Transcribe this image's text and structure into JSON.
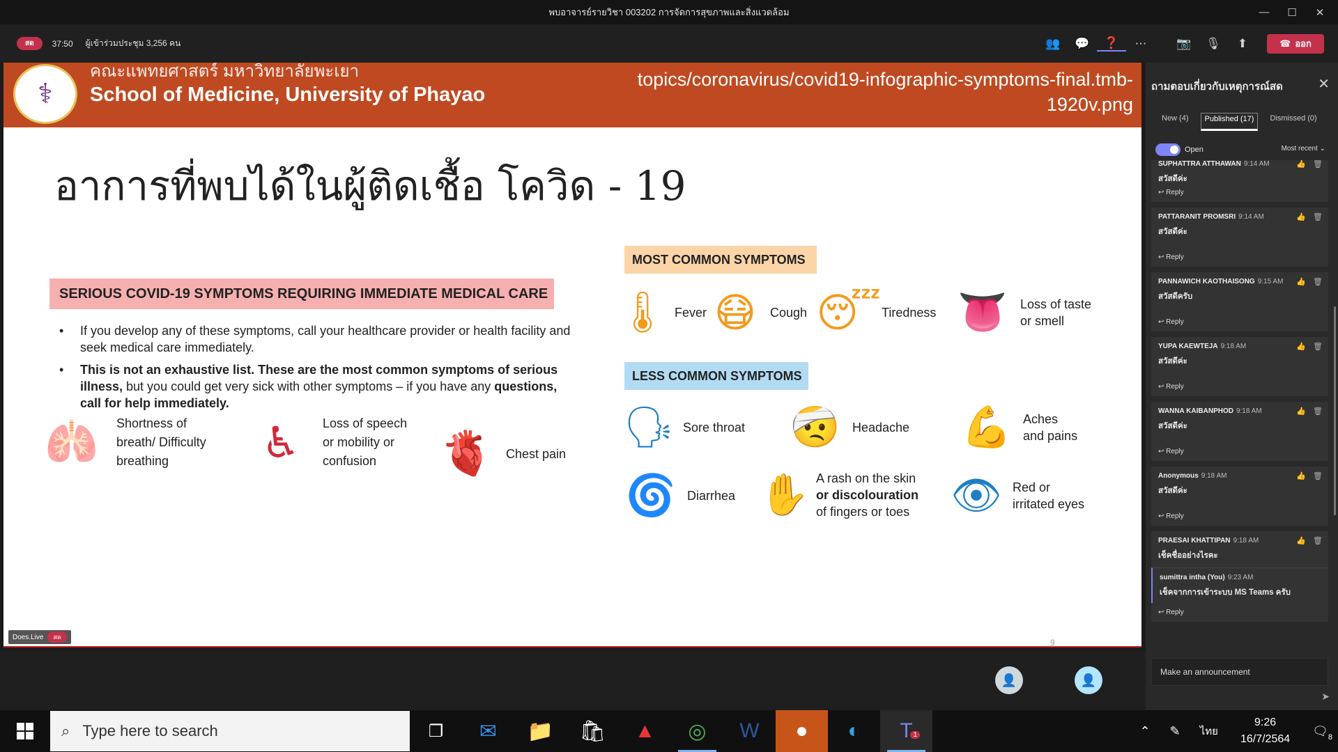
{
  "window": {
    "title": "พบอาจารย์รายวิชา 003202 การจัดการสุขภาพและสิ่งแวดล้อม",
    "minimize": "—",
    "maximize": "☐",
    "close": "✕"
  },
  "meeting": {
    "live_badge": "สด",
    "timer": "37:50",
    "attendees": "ผู้เข้าร่วมประชุม 3,256 คน",
    "leave_label": "ออก"
  },
  "slide": {
    "header_thai": "คณะแพทยศาสตร์ มหาวิทยาลัยพะเยา",
    "header_en": "School of Medicine, University of Phayao",
    "url_line1": "topics/coronavirus/covid19-infographic-symptoms-final.tmb-",
    "url_line2": "1920v.png",
    "title": "อาการที่พบได้ในผู้ติดเชื้อ โควิด - 19",
    "serious_label": "SERIOUS COVID-19 SYMPTOMS REQUIRING IMMEDIATE MEDICAL CARE",
    "bullet1": "If you develop any of these symptoms, call your healthcare provider or health facility and seek medical care immediately.",
    "bullet2_bold1": "This is not an exhaustive list.  These are the most common symptoms of serious illness,",
    "bullet2_plain": " but you could get very sick with other symptoms – if you have any ",
    "bullet2_bold2": "questions, call for help immediately.",
    "serious": [
      {
        "line1": "Shortness of",
        "line2": "breath/ Difficulty",
        "line3": "breathing",
        "icon": "🫁"
      },
      {
        "line1": "Loss of speech",
        "line2": "or mobility or",
        "line3": "confusion",
        "icon": "♿"
      },
      {
        "label": "Chest pain",
        "icon": "🫀"
      }
    ],
    "common_label": "MOST COMMON SYMPTOMS",
    "common": [
      {
        "label": "Fever",
        "icon": "🌡"
      },
      {
        "label": "Cough",
        "icon": "😷"
      },
      {
        "label": "Tiredness",
        "icon": "😴"
      },
      {
        "line1": "Loss of taste",
        "line2": "or smell",
        "icon": "👅"
      }
    ],
    "less_label": "LESS COMMON SYMPTOMS",
    "less": [
      {
        "label": "Sore throat",
        "icon": "🗣"
      },
      {
        "label": "Headache",
        "icon": "🤕"
      },
      {
        "line1": "Aches",
        "line2": "and pains",
        "icon": "💪"
      },
      {
        "label": "Diarrhea",
        "icon": "🌀"
      },
      {
        "line1": "A rash on the skin",
        "line2": "or discolouration",
        "line3": "of fingers or toes",
        "icon": "✋"
      },
      {
        "line1": "Red or",
        "line2": "irritated eyes",
        "icon": "👁"
      }
    ],
    "doeslive": "Does.Live",
    "doeslive_badge": "สด",
    "page_number": "9"
  },
  "panel": {
    "title": "ถามตอบเกี่ยวกับเหตุการณ์สด",
    "tabs": [
      "New (4)",
      "Published (17)",
      "Dismissed (0)"
    ],
    "toggle_label": "Open",
    "sort_label": "Most recent",
    "reply": "Reply",
    "questions": [
      {
        "name": "SUPHATTRA ATTHAWAN",
        "time": "9:14 AM",
        "text": "สวัสดีค่ะ"
      },
      {
        "name": "PATTARANIT PROMSRI",
        "time": "9:14 AM",
        "text": "สวัสดีค่ะ"
      },
      {
        "name": "PANNAWICH KAOTHAISONG",
        "time": "9:15 AM",
        "text": "สวัสดีครับ"
      },
      {
        "name": "YUPA KAEWTEJA",
        "time": "9:18 AM",
        "text": "สวัสดีค่ะ"
      },
      {
        "name": "WANNA KAIBANPHOD",
        "time": "9:18 AM",
        "text": "สวัสดีค่ะ"
      },
      {
        "name": "Anonymous",
        "time": "9:18 AM",
        "text": "สวัสดีค่ะ"
      },
      {
        "name": "PRAESAI KHATTIPAN",
        "time": "9:18 AM",
        "text": "เช็คชื่ออย่างไรคะ"
      }
    ],
    "my_reply": {
      "name": "sumittra intha (You)",
      "time": "9:23 AM",
      "text": "เช็คจากการเข้าระบบ MS Teams ครับ"
    },
    "announce_placeholder": "Make an announcement"
  },
  "taskbar": {
    "search_placeholder": "Type here to search",
    "language": "ไทย",
    "time": "9:26",
    "date": "16/7/2564",
    "notif_count": "8",
    "teams_badge": "1"
  }
}
